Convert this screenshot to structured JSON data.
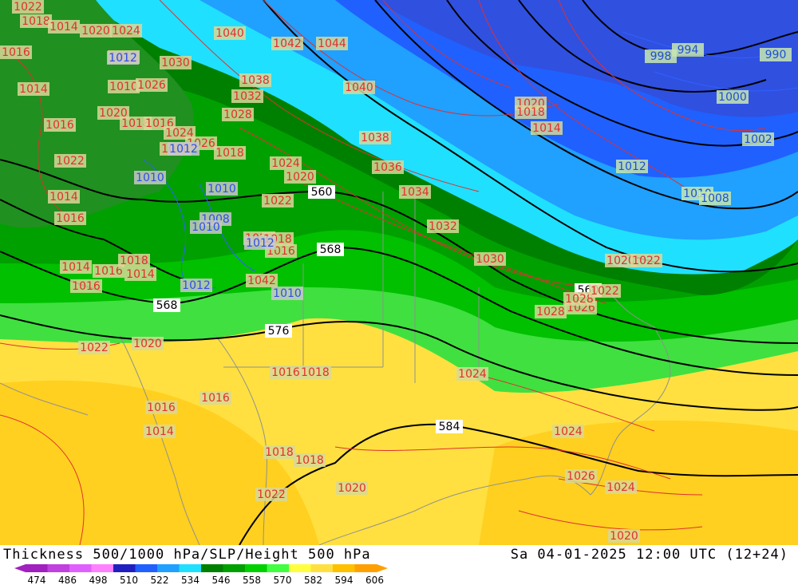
{
  "title": "Thickness 500/1000 hPa/SLP/Height 500 hPa",
  "valid_time": "Sa 04-01-2025 12:00 UTC (12+24)",
  "legend": {
    "ticks": [
      "474",
      "486",
      "498",
      "510",
      "522",
      "534",
      "546",
      "558",
      "570",
      "582",
      "594",
      "606"
    ],
    "colors": [
      "#a020c0",
      "#c040e0",
      "#e060ff",
      "#ff80ff",
      "#2020c0",
      "#2060ff",
      "#20a0ff",
      "#20e0ff",
      "#008000",
      "#00a000",
      "#00d000",
      "#40ff40",
      "#ffff40",
      "#ffe040",
      "#ffc000",
      "#ffa000"
    ]
  },
  "height_labels": [
    "560",
    "568",
    "568",
    "576",
    "584",
    "560"
  ],
  "slp_labels": {
    "red": [
      "1022",
      "1018",
      "1014",
      "1020",
      "1024",
      "1016",
      "1012",
      "1030",
      "1040",
      "1042",
      "1044",
      "1014",
      "1010",
      "1026",
      "1038",
      "1032",
      "1028",
      "1016",
      "1020",
      "1018",
      "1016",
      "1024",
      "1026",
      "1020",
      "1018",
      "1022",
      "1024",
      "1020",
      "1014",
      "1016",
      "1022",
      "1014",
      "1016",
      "1018",
      "1014",
      "1016",
      "1020",
      "1018",
      "1016",
      "1042",
      "1040",
      "1038",
      "1036",
      "1034",
      "1032",
      "1030",
      "1028",
      "1026",
      "1028",
      "1024",
      "1022",
      "1020",
      "1022",
      "1020",
      "1018",
      "1014",
      "1022",
      "1020",
      "1024",
      "1026",
      "1024",
      "1022",
      "1020",
      "1020",
      "1018",
      "1016",
      "1018",
      "1016",
      "1016",
      "1014",
      "1018"
    ],
    "blue": [
      "1012",
      "1012",
      "1010",
      "1010",
      "1008",
      "1010",
      "1012",
      "1010",
      "1012"
    ],
    "cyan": [
      "998",
      "994",
      "990",
      "1000",
      "1002",
      "1012",
      "1010",
      "1008"
    ]
  },
  "colors": {
    "slp_line": "#e03030",
    "height_line": "#000000",
    "coast": "#909090"
  }
}
